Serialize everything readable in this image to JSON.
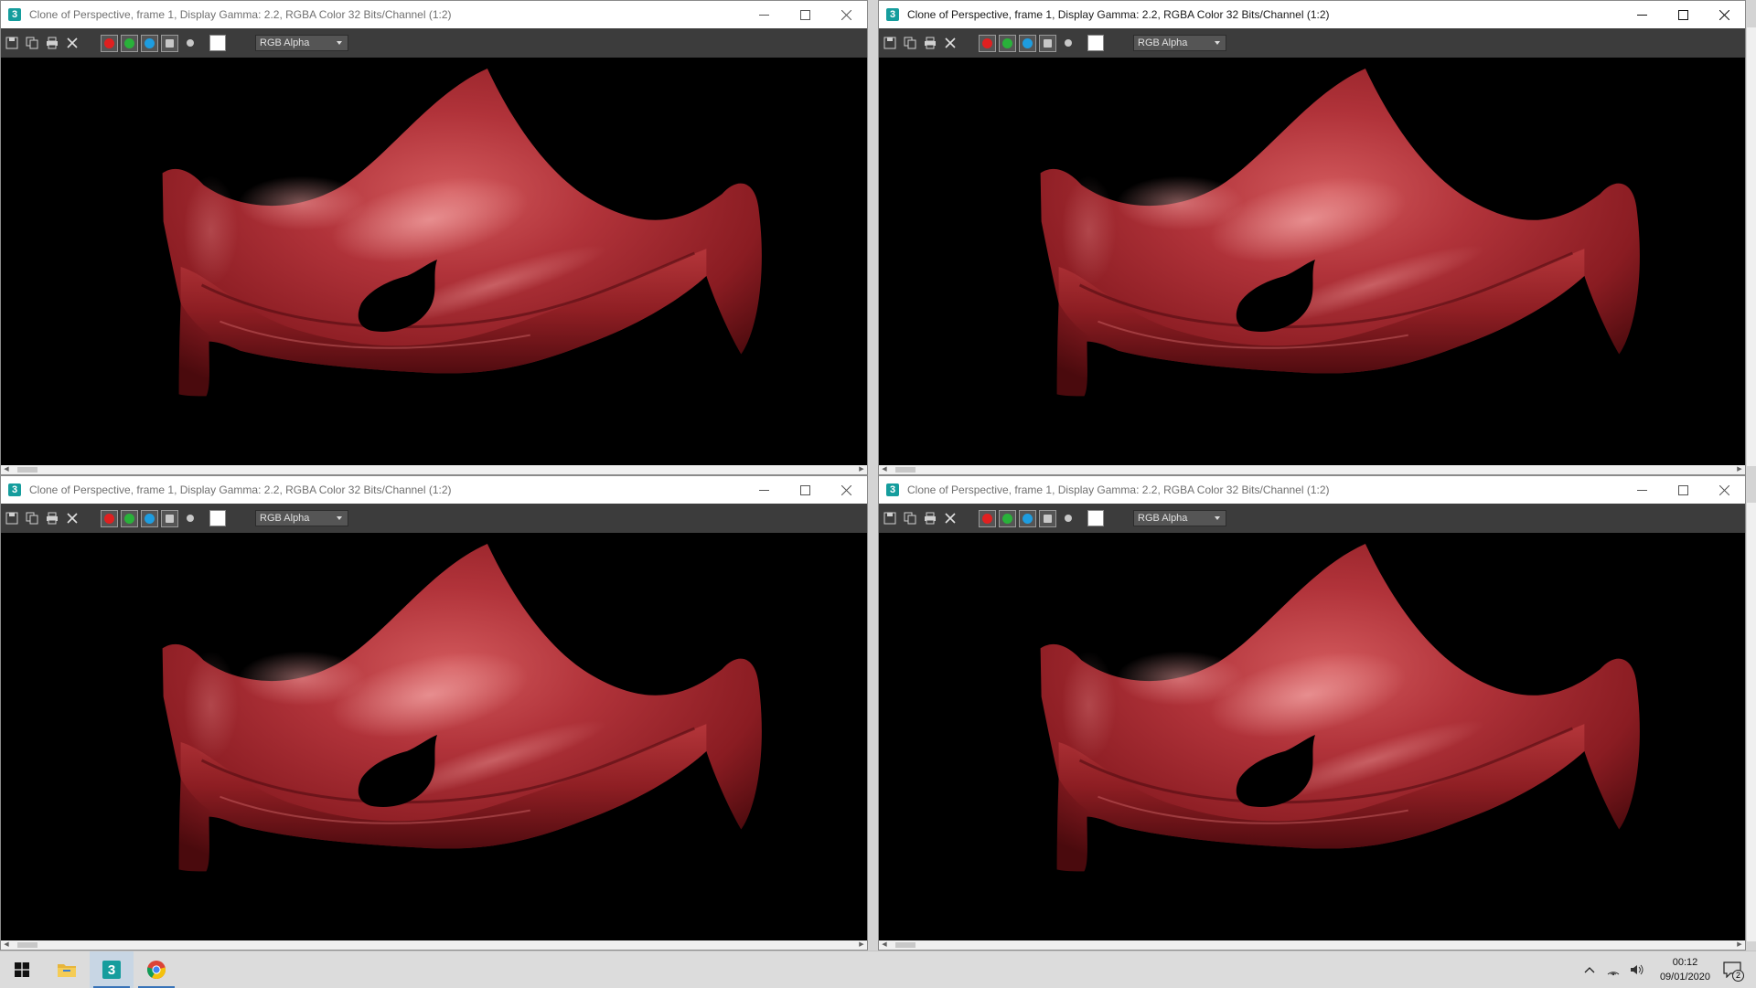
{
  "windows": [
    {
      "id": "top-left",
      "title": "Clone of Perspective, frame 1, Display Gamma: 2.2, RGBA Color 32 Bits/Channel (1:2)",
      "channel_select": "RGB Alpha",
      "active": false
    },
    {
      "id": "top-right",
      "title": "Clone of Perspective, frame 1, Display Gamma: 2.2, RGBA Color 32 Bits/Channel (1:2)",
      "channel_select": "RGB Alpha",
      "active": true
    },
    {
      "id": "bottom-left",
      "title": "Clone of Perspective, frame 1, Display Gamma: 2.2, RGBA Color 32 Bits/Channel (1:2)",
      "channel_select": "RGB Alpha",
      "active": false
    },
    {
      "id": "bottom-right",
      "title": "Clone of Perspective, frame 1, Display Gamma: 2.2, RGBA Color 32 Bits/Channel (1:2)",
      "channel_select": "RGB Alpha",
      "active": false
    }
  ],
  "app_icon_glyph": "3",
  "colors": {
    "cloth": "#a8262b",
    "cloth_dark": "#5c0d10",
    "cloth_highlight": "#e0787a",
    "channel_red": "#e02020",
    "channel_green": "#29b23a",
    "channel_blue": "#1e9de0",
    "toolbar_bg": "#3c3c3c"
  },
  "taskbar": {
    "pinned": [
      {
        "name": "start",
        "icon": "windows-logo-icon"
      },
      {
        "name": "file-explorer",
        "icon": "folder-icon"
      },
      {
        "name": "3ds-max",
        "icon": "3ds-max-icon",
        "glyph": "3"
      },
      {
        "name": "chrome",
        "icon": "chrome-icon"
      }
    ],
    "clock": {
      "time": "00:12",
      "date": "09/01/2020"
    },
    "notification_count": "2"
  }
}
